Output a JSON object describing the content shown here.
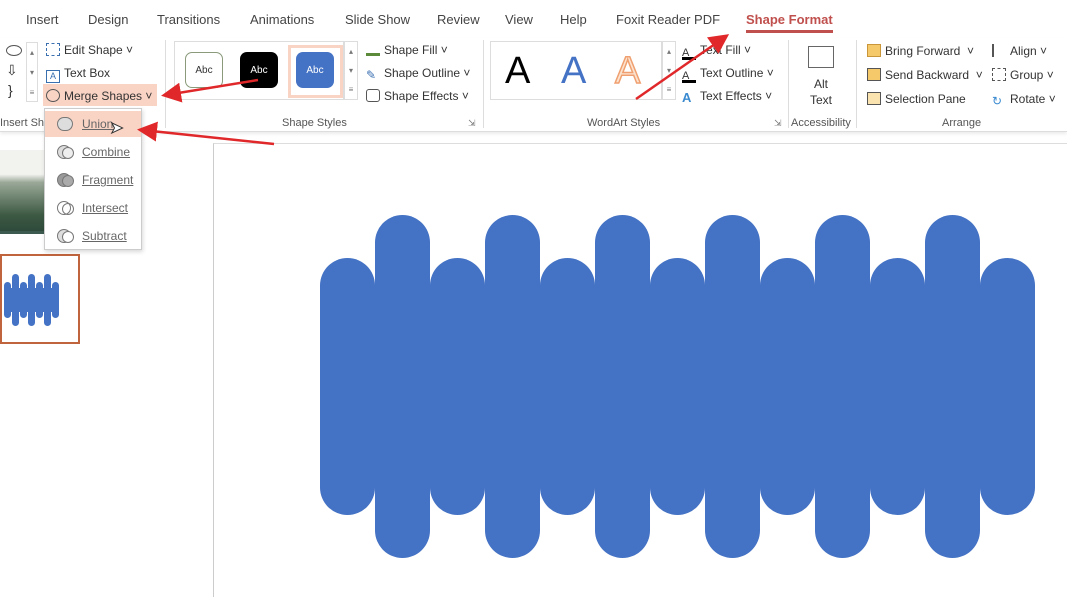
{
  "tabs": [
    "Insert",
    "Design",
    "Transitions",
    "Animations",
    "Slide Show",
    "Review",
    "View",
    "Help",
    "Foxit Reader PDF",
    "Shape Format"
  ],
  "active_tab": "Shape Format",
  "insert_shapes": {
    "edit_shape": "Edit Shape",
    "text_box": "Text Box",
    "merge_shapes": "Merge Shapes",
    "group_label": "Insert Sha"
  },
  "shape_styles": {
    "presets": [
      "Abc",
      "Abc",
      "Abc"
    ],
    "fill": "Shape Fill",
    "outline": "Shape Outline",
    "effects": "Shape Effects",
    "group_label": "Shape Styles"
  },
  "wordart": {
    "presets": [
      "A",
      "A",
      "A"
    ],
    "text_fill": "Text Fill",
    "text_outline": "Text Outline",
    "text_effects": "Text Effects",
    "group_label": "WordArt Styles"
  },
  "accessibility": {
    "alt_text_1": "Alt",
    "alt_text_2": "Text",
    "group_label": "Accessibility"
  },
  "arrange": {
    "bring_forward": "Bring Forward",
    "send_backward": "Send Backward",
    "selection_pane": "Selection Pane",
    "align": "Align",
    "group": "Group",
    "rotate": "Rotate",
    "group_label": "Arrange"
  },
  "merge_menu": [
    "Union",
    "Combine",
    "Fragment",
    "Intersect",
    "Subtract"
  ],
  "hovered_item": "Union",
  "colors": {
    "accent": "#c0504d",
    "shape": "#4472c4",
    "highlight": "#f9d3c4",
    "arrow": "#e0282a"
  }
}
